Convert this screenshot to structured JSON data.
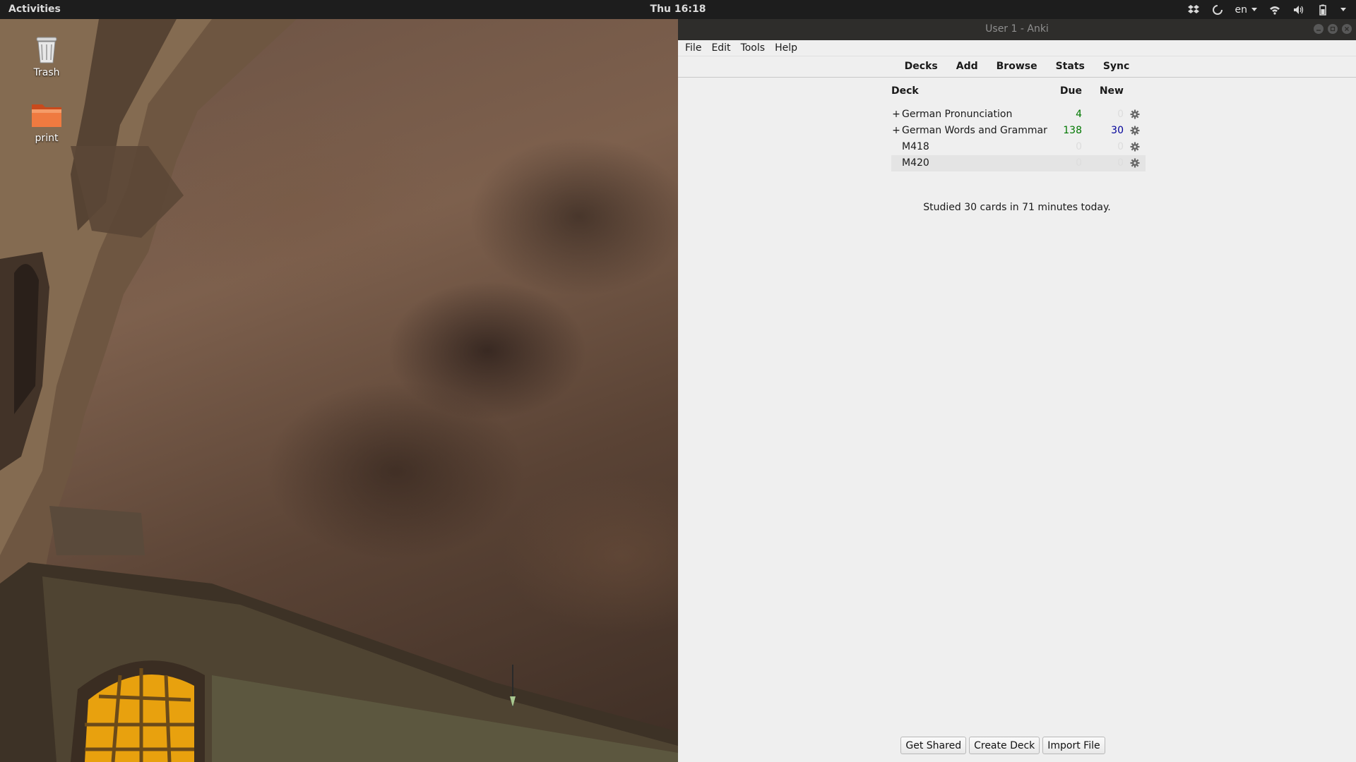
{
  "topbar": {
    "activities": "Activities",
    "clock": "Thu 16:18",
    "lang": "en",
    "tray_icons": [
      "dropbox-icon",
      "sync-spinner-icon",
      "wifi-icon",
      "volume-icon",
      "battery-icon"
    ]
  },
  "desktop": {
    "icons": [
      {
        "label": "Trash",
        "icon": "trash-icon"
      },
      {
        "label": "print",
        "icon": "folder-icon"
      }
    ]
  },
  "window": {
    "title": "User 1 - Anki",
    "menu": [
      "File",
      "Edit",
      "Tools",
      "Help"
    ],
    "toolbar": [
      "Decks",
      "Add",
      "Browse",
      "Stats",
      "Sync"
    ],
    "deck_table": {
      "headers": {
        "deck": "Deck",
        "due": "Due",
        "new": "New"
      },
      "rows": [
        {
          "expand": "+",
          "name": "German Pronunciation",
          "due": "4",
          "new": "0"
        },
        {
          "expand": "+",
          "name": "German Words and Grammar",
          "due": "138",
          "new": "30"
        },
        {
          "expand": "",
          "name": "M418",
          "due": "0",
          "new": "0"
        },
        {
          "expand": "",
          "name": "M420",
          "due": "0",
          "new": "0"
        }
      ]
    },
    "studied": "Studied 30 cards in 71 minutes today.",
    "bottom_buttons": [
      "Get Shared",
      "Create Deck",
      "Import File"
    ]
  },
  "colors": {
    "due": "#007700",
    "new": "#000099",
    "zero": "#dddddd",
    "topbar_bg": "#1d1d1d",
    "titlebar_bg": "#2e2d2b",
    "window_bg": "#efefef"
  }
}
